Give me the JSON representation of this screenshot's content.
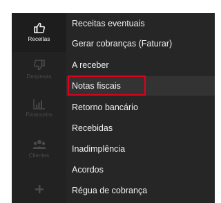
{
  "sidebar": {
    "items": [
      {
        "label": "Receitas",
        "icon": "thumbs-up-icon",
        "active": true
      },
      {
        "label": "Despesas",
        "icon": "thumbs-down-icon",
        "active": false
      },
      {
        "label": "Financeiro",
        "icon": "bar-chart-icon",
        "active": false
      },
      {
        "label": "Clientes",
        "icon": "users-icon",
        "active": false
      },
      {
        "label": "",
        "icon": "plus-icon",
        "active": false
      }
    ]
  },
  "submenu": {
    "items": [
      {
        "label": "Receitas eventuais"
      },
      {
        "label": "Gerar cobranças (Faturar)"
      },
      {
        "label": "A receber"
      },
      {
        "label": "Notas fiscais",
        "selected": true
      },
      {
        "label": "Retorno bancário"
      },
      {
        "label": "Recebidas"
      },
      {
        "label": "Inadimplência"
      },
      {
        "label": "Acordos"
      },
      {
        "label": "Régua de cobrança"
      }
    ]
  },
  "colors": {
    "panel_bg": "#262626",
    "sidebar_bg": "#222222",
    "highlight_border": "#e0001a",
    "text": "#f1f1f1",
    "muted_text": "#4a4a4a"
  }
}
